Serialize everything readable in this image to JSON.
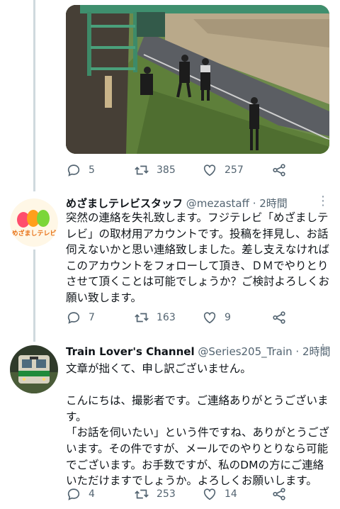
{
  "tweet1": {
    "stats": {
      "replies": "5",
      "retweets": "385",
      "likes": "257"
    }
  },
  "tweet2": {
    "display_name": "めざましテレビスタッフ",
    "handle": "@mezastaff",
    "time": "· 2時間",
    "avatar_text": "めざましテレビ",
    "text": "突然の連絡を失礼致します。フジテレビ「めざましテレビ」の取材用アカウントです。投稿を拝見し、お話伺えないかと思い連絡致しました。差し支えなければこのアカウントをフォローして頂き、ＤＭでやりとりさせて頂くことは可能でしょうか？ご検討よろしくお願い致します。",
    "stats": {
      "replies": "7",
      "retweets": "163",
      "likes": "9"
    }
  },
  "tweet3": {
    "display_name": "Train Lover's Channel",
    "handle": "@Series205_Train",
    "time": "· 2時間",
    "text": "文章が拙くて、申し訳ございません。\n\nこんにちは、撮影者です。ご連絡ありがとうございます。\n「お話を伺いたい」という件ですね、ありがとうございます。その件ですが、メールでのやりとりなら可能でございます。お手数ですが、私のDMの方にご連絡いただけますでしょうか。よろしくお願いします。",
    "stats": {
      "replies": "4",
      "retweets": "253",
      "likes": "14"
    }
  },
  "colors": {
    "icon_gray": "#536471",
    "thread_line": "#cfd9de",
    "avatar_red": "#ff4d6d",
    "avatar_orange": "#ff9f1c",
    "avatar_green": "#7bd639"
  }
}
